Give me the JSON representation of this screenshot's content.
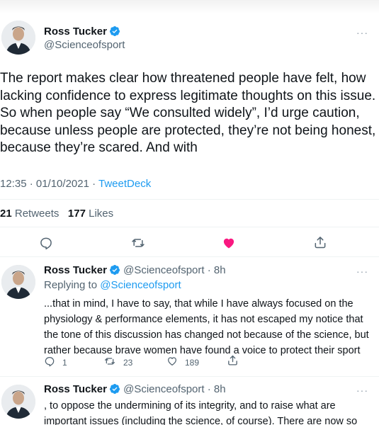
{
  "main_tweet": {
    "author_name": "Ross Tucker",
    "handle": "@Scienceofsport",
    "text": "The report makes clear how threatened people have felt, how lacking confidence to express legitimate thoughts on this issue. So when people say “We consulted widely”, I’d urge caution, because unless people are protected, they’re not being honest, because they’re scared. And with",
    "time": "12:35 · 01/10/2021 · ",
    "source": "TweetDeck",
    "retweets_count": "21",
    "retweets_label": "Retweets",
    "likes_count": "177",
    "likes_label": "Likes",
    "liked": true,
    "like_color": "#f91880"
  },
  "replies": [
    {
      "author_name": "Ross Tucker",
      "handle_time": "@Scienceofsport · 8h",
      "replying_prefix": "Replying to ",
      "replying_to": "@Scienceofsport",
      "text": "...that in mind, I have to say, that while I have always focused on the physiology & performance elements, it has not escaped my notice that the tone of this discussion has changed not because of the science, but rather because brave women have found a voice to protect their sport",
      "reply_count": "1",
      "retweet_count": "23",
      "like_count": "189"
    },
    {
      "author_name": "Ross Tucker",
      "handle_time": "@Scienceofsport · 8h",
      "text": ", to oppose the undermining of its integrity, and to raise what are important issues (including the science, of course). There are now so"
    }
  ],
  "icons": {
    "verified": "verified-badge-icon",
    "more": "more-horizontal-icon",
    "reply": "reply-icon",
    "retweet": "retweet-icon",
    "like": "heart-icon",
    "share": "share-icon"
  },
  "colors": {
    "accent": "#1d9bf0",
    "text": "#0f1419",
    "secondary": "#536471",
    "like": "#f91880"
  },
  "more_glyph": "···"
}
